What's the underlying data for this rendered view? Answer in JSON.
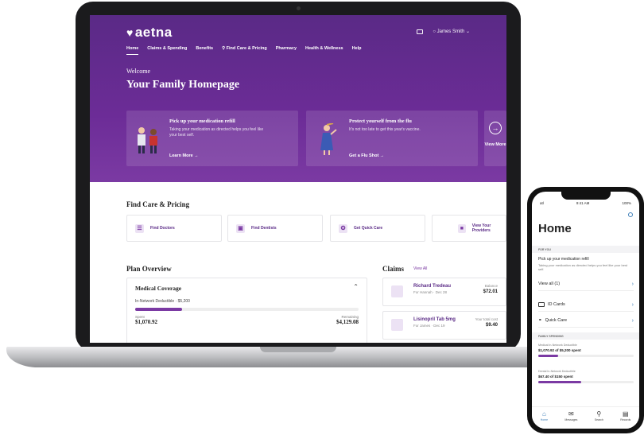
{
  "app": {
    "logo": "aetna",
    "user": "James Smith"
  },
  "nav": {
    "items": [
      "Home",
      "Claims & Spending",
      "Benefits",
      "Find Care & Pricing",
      "Pharmacy",
      "Health & Wellness",
      "Help"
    ],
    "active": "Home"
  },
  "hero": {
    "welcome": "Welcome",
    "title": "Your Family Homepage"
  },
  "promos": [
    {
      "title": "Pick up your medication refill",
      "desc": "Taking your medication as directed helps you feel like your best self.",
      "link": "Learn More →"
    },
    {
      "title": "Protect yourself from the flu",
      "desc": "It's not too late to get this year's vaccine.",
      "link": "Get a Flu Shot →"
    }
  ],
  "view_more": "View More",
  "find_care": {
    "title": "Find Care & Pricing",
    "items": [
      "Find Doctors",
      "Find Dentists",
      "Get Quick Care",
      "View Your Providers"
    ]
  },
  "plan": {
    "title": "Plan Overview",
    "coverage": "Medical Coverage",
    "deductible": "In-Network Deductible · $5,200",
    "spent_label": "Spent",
    "spent": "$1,070.92",
    "remaining_label": "Remaining",
    "remaining": "$4,129.08",
    "progress": 0.21
  },
  "claims": {
    "title": "Claims",
    "view_all": "View All",
    "items": [
      {
        "name": "Richard Tredeau",
        "sub": "For Hannah · Dec 28",
        "label": "Balance",
        "amount": "$72.01"
      },
      {
        "name": "Lisinopril Tab 5mg",
        "sub": "For James · Dec 19",
        "label": "Your total cost",
        "amount": "$9.40"
      }
    ]
  },
  "phone": {
    "status_left": "atl",
    "status_time": "9:41 AM",
    "status_right": "100%",
    "title": "Home",
    "for_you": "FOR YOU",
    "refill_title": "Pick up your medication refill",
    "refill_desc": "Taking your medication as directed helps you feel like your best self.",
    "view_all": "View all (1)",
    "id_cards": "ID Cards",
    "quick_care": "Quick Care",
    "family_spending": "FAMILY SPENDING",
    "spend1_label": "Medical In-Network Deductible",
    "spend1_value": "$1,070.92 of $5,200 spent",
    "spend1_progress": 0.21,
    "spend2_label": "Dental In-Network Deductible",
    "spend2_value": "$67.40 of $150 spent",
    "spend2_progress": 0.45,
    "tabs": [
      "Home",
      "Messages",
      "Search",
      "Records"
    ]
  }
}
